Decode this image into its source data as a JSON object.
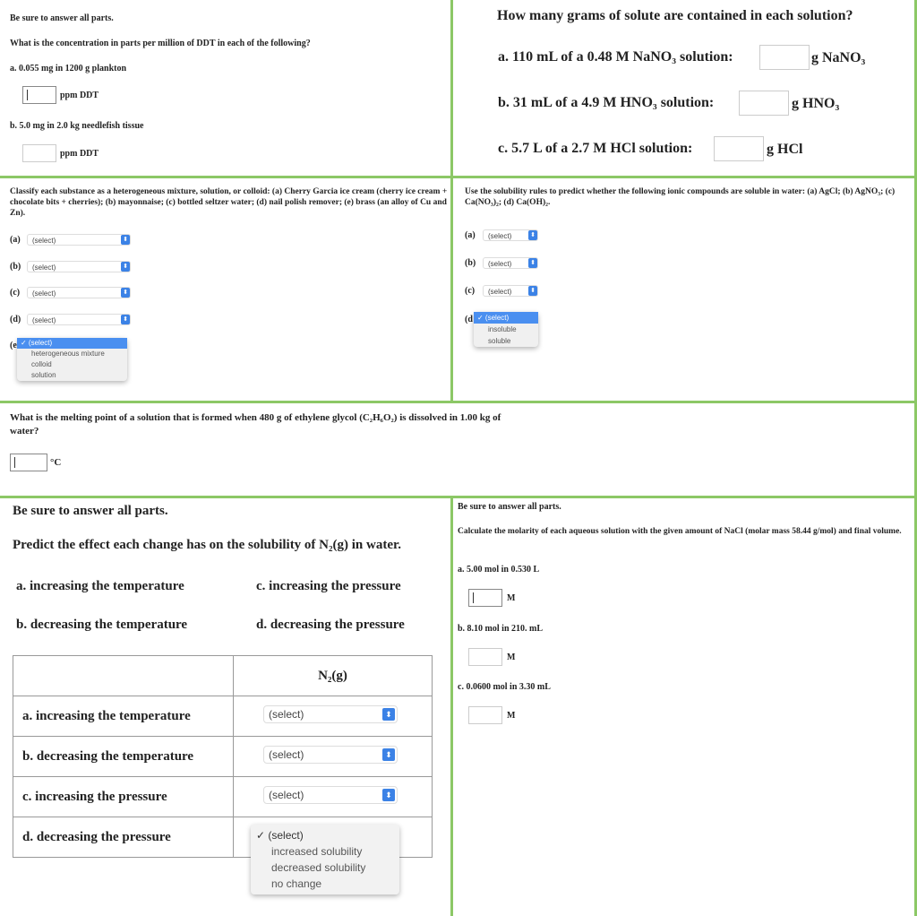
{
  "p1": {
    "instr": "Be sure to answer all parts.",
    "question": "What is the concentration in parts per million of DDT in each of the following?",
    "a": "a. 0.055 mg in 1200 g plankton",
    "b": "b. 5.0 mg in 2.0 kg needlefish tissue",
    "unit": "ppm DDT"
  },
  "p2": {
    "question": "How many grams of solute are contained in each solution?",
    "a": "a. 110 mL of a 0.48 M NaNO₃ solution:",
    "a_unit": "g NaNO₃",
    "b": "b. 31 mL of a 4.9 M HNO₃ solution:",
    "b_unit": "g HNO₃",
    "c": "c. 5.7 L of a 2.7 M HCl solution:",
    "c_unit": "g HCl"
  },
  "p3": {
    "question": "Classify each substance as a heterogeneous mixture, solution, or colloid: (a) Cherry Garcia ice cream (cherry ice cream + chocolate bits + cherries); (b) mayonnaise; (c) bottled seltzer water; (d) nail polish remover; (e) brass (an alloy of Cu and Zn).",
    "labels": [
      "(a)",
      "(b)",
      "(c)",
      "(d)",
      "(e"
    ],
    "select": "(select)",
    "options": [
      "✓ (select)",
      "heterogeneous mixture",
      "colloid",
      "solution"
    ]
  },
  "p4": {
    "question": "Use the solubility rules to predict whether the following ionic compounds are soluble in water: (a) AgCl; (b) AgNO₃; (c) Ca(NO₃)₂; (d) Ca(OH)₂.",
    "labels": [
      "(a)",
      "(b)",
      "(c)",
      "(d"
    ],
    "select": "(select)",
    "options": [
      "✓ (select)",
      "insoluble",
      "soluble"
    ]
  },
  "p5": {
    "question": "What is the melting point of a solution that is formed when 480 g of ethylene glycol (C₂H₆O₂) is dissolved in 1.00 kg of water?",
    "unit": "°C"
  },
  "p6": {
    "instr": "Be sure to answer all parts.",
    "question": "Predict the effect each change has on the solubility of N₂(g) in water.",
    "a": "a. increasing the temperature",
    "b": "b. decreasing the temperature",
    "c": "c. increasing the pressure",
    "d": "d. decreasing the pressure",
    "col": "N₂(g)",
    "rows": [
      "a. increasing the temperature",
      "b. decreasing the temperature",
      "c. increasing the pressure",
      "d. decreasing the pressure"
    ],
    "select": "(select)",
    "options": [
      "✓ (select)",
      "increased solubility",
      "decreased solubility",
      "no change"
    ]
  },
  "p7": {
    "instr": "Be sure to answer all parts.",
    "question": "Calculate the molarity of each aqueous solution with the given amount of NaCl (molar mass 58.44 g/mol) and final volume.",
    "a": "a. 5.00 mol in 0.530 L",
    "b": "b. 8.10 mol in 210. mL",
    "c": "c. 0.0600 mol in 3.30 mL",
    "unit": "M"
  }
}
